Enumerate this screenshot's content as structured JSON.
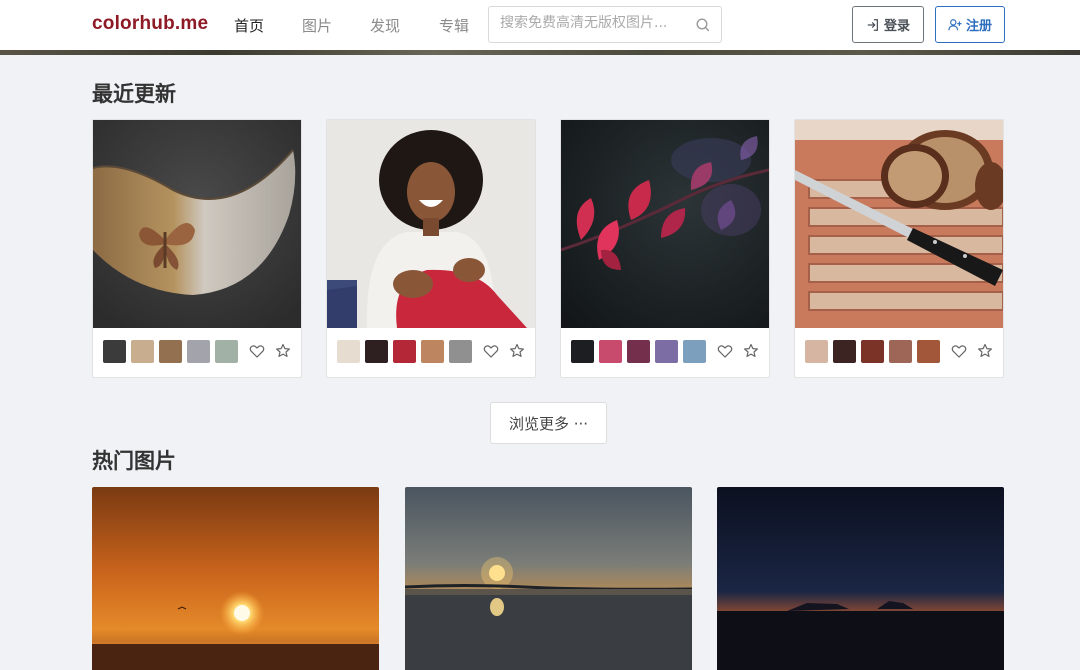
{
  "header": {
    "logo": "colorhub.me",
    "nav": [
      "首页",
      "图片",
      "发现",
      "专辑"
    ],
    "search_placeholder": "搜索免费高清无版权图片...",
    "login_label": "登录",
    "register_label": "注册",
    "brand_color": "#8e1a26",
    "accent_color": "#2e6fbf"
  },
  "recent": {
    "title": "最近更新",
    "cards": [
      {
        "subject": "butterfly-pendant-photo",
        "swatches": [
          "#3b3b3b",
          "#c8ad8f",
          "#93704f",
          "#a2a3ab",
          "#a2b1a5"
        ]
      },
      {
        "subject": "laughing-woman-photo",
        "swatches": [
          "#e6dcd0",
          "#2e2020",
          "#b42737",
          "#bd8560",
          "#909090"
        ]
      },
      {
        "subject": "red-leaves-photo",
        "swatches": [
          "#1c1e21",
          "#c84a6c",
          "#732f4b",
          "#7c6ea5",
          "#7c9fbd"
        ]
      },
      {
        "subject": "bread-knife-photo",
        "swatches": [
          "#d6b6a3",
          "#3b2421",
          "#7b3327",
          "#9d6656",
          "#a2573b"
        ]
      }
    ],
    "more_label": "浏览更多 ···"
  },
  "popular": {
    "title": "热门图片",
    "cards": [
      {
        "subject": "orange-sunset-sea-photo"
      },
      {
        "subject": "sunset-lake-reflection-photo"
      },
      {
        "subject": "dusk-horizon-photo"
      }
    ]
  }
}
